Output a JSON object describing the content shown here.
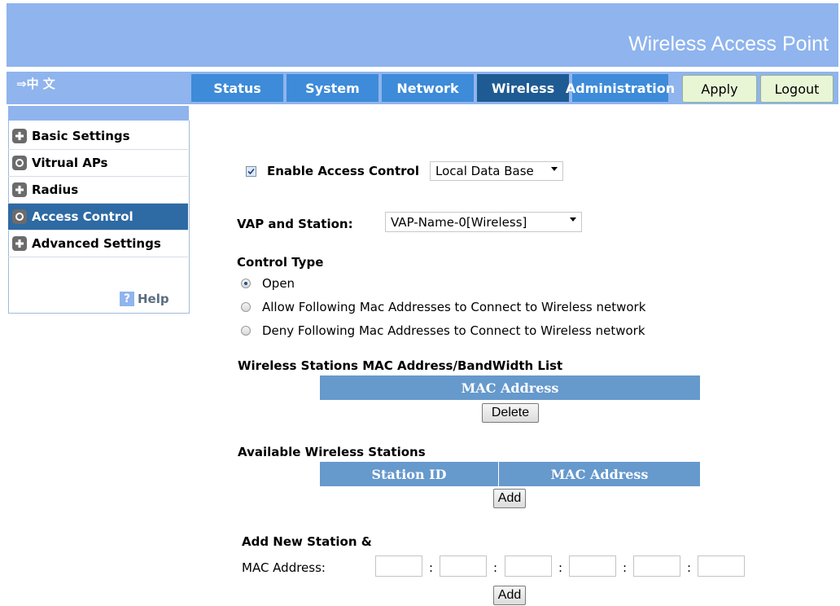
{
  "banner": {
    "title": "Wireless Access Point"
  },
  "lang": {
    "label": "⇒中 文"
  },
  "nav": {
    "tabs": [
      {
        "label": "Status"
      },
      {
        "label": "System"
      },
      {
        "label": "Network"
      },
      {
        "label": "Wireless",
        "active": true
      },
      {
        "label": "Administration"
      }
    ],
    "apply_label": "Apply",
    "logout_label": "Logout"
  },
  "sidebar": {
    "items": [
      {
        "label": "Basic Settings",
        "icon": "plus-icon"
      },
      {
        "label": "Vitrual APs",
        "icon": "circle-icon"
      },
      {
        "label": "Radius",
        "icon": "plus-icon"
      },
      {
        "label": "Access Control",
        "icon": "circle-icon",
        "active": true
      },
      {
        "label": "Advanced Settings",
        "icon": "plus-icon"
      }
    ],
    "help_icon": "?",
    "help_label": "Help"
  },
  "access": {
    "enable_label": "Enable Access Control",
    "enable_checked": true,
    "db_value": "Local Data Base",
    "vap_label": "VAP and Station:",
    "vap_value": "VAP-Name-0[Wireless]",
    "control_type_label": "Control Type",
    "options": [
      {
        "label": "Open",
        "selected": true
      },
      {
        "label": "Allow Following Mac Addresses to Connect to Wireless network",
        "selected": false
      },
      {
        "label": "Deny Following Mac Addresses to Connect to Wireless network",
        "selected": false
      }
    ],
    "mac_list_title": "Wireless Stations MAC Address/BandWidth List",
    "mac_list_header": "MAC Address",
    "delete_label": "Delete",
    "available_title": "Available Wireless Stations",
    "available_headers": [
      "Station ID",
      "MAC Address"
    ],
    "add_label": "Add",
    "add_new_title": "Add New Station &",
    "mac_address_label": "MAC Address:",
    "mac_fields": [
      "",
      "",
      "",
      "",
      "",
      ""
    ],
    "add_label_2": "Add"
  },
  "colors": {
    "banner": "#8fb4ee",
    "tab": "#3d8bd9",
    "tab_active": "#1f5b93",
    "table_header": "#6699cc",
    "sidebar_active": "#2e6aa3"
  }
}
